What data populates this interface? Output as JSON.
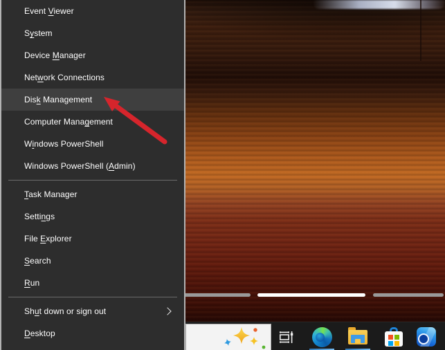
{
  "window": {
    "type": "windows-power-user-menu-screenshot"
  },
  "menu": {
    "items": [
      {
        "label": "Event Viewer",
        "pre": "Event ",
        "accel": "V",
        "post": "iewer"
      },
      {
        "label": "System",
        "pre": "S",
        "accel": "y",
        "post": "stem"
      },
      {
        "label": "Device Manager",
        "pre": "Device ",
        "accel": "M",
        "post": "anager"
      },
      {
        "label": "Network Connections",
        "pre": "Net",
        "accel": "w",
        "post": "ork Connections"
      },
      {
        "label": "Disk Management",
        "pre": "Dis",
        "accel": "k",
        "post": " Management",
        "highlighted": true
      },
      {
        "label": "Computer Management",
        "pre": "Computer Mana",
        "accel": "g",
        "post": "ement"
      },
      {
        "label": "Windows PowerShell",
        "pre": "W",
        "accel": "i",
        "post": "ndows PowerShell"
      },
      {
        "label": "Windows PowerShell (Admin)",
        "pre": "Windows PowerShell (",
        "accel": "A",
        "post": "dmin)"
      },
      {
        "separator": true
      },
      {
        "label": "Task Manager",
        "pre": "",
        "accel": "T",
        "post": "ask Manager"
      },
      {
        "label": "Settings",
        "pre": "Setti",
        "accel": "n",
        "post": "gs"
      },
      {
        "label": "File Explorer",
        "pre": "File ",
        "accel": "E",
        "post": "xplorer"
      },
      {
        "label": "Search",
        "pre": "",
        "accel": "S",
        "post": "earch"
      },
      {
        "label": "Run",
        "pre": "",
        "accel": "R",
        "post": "un"
      },
      {
        "separator": true
      },
      {
        "label": "Shut down or sign out",
        "pre": "Sh",
        "accel": "u",
        "post": "t down or sign out",
        "submenu": true
      },
      {
        "label": "Desktop",
        "pre": "",
        "accel": "D",
        "post": "esktop"
      }
    ],
    "highlighted_item": "Disk Management"
  },
  "annotation": {
    "shape": "arrow",
    "color": "#d6252c",
    "target": "Disk Management"
  },
  "desktop": {
    "carousel_indicator": {
      "segments": [
        "inactive",
        "active",
        "inactive"
      ],
      "active_color": "#ffffff",
      "inactive_color": "#9a9a9a"
    }
  },
  "taskbar": {
    "search_icon": "search-highlights-sparkle-icon",
    "buttons": [
      {
        "name": "task-view",
        "running": false
      },
      {
        "name": "microsoft-edge",
        "running": true
      },
      {
        "name": "file-explorer",
        "running": true
      },
      {
        "name": "microsoft-store",
        "running": false
      },
      {
        "name": "outlook",
        "running": false
      }
    ],
    "running_indicator_color": "#5aa7e6"
  },
  "colors": {
    "menu_bg": "#2d2d2d",
    "menu_highlight": "#3f3f3f",
    "menu_text": "#ffffff",
    "menu_border": "#b3b3b3",
    "taskbar_bg": "#1b1b1b",
    "search_box_bg": "#f3f3f3",
    "arrow_red": "#d6252c"
  }
}
